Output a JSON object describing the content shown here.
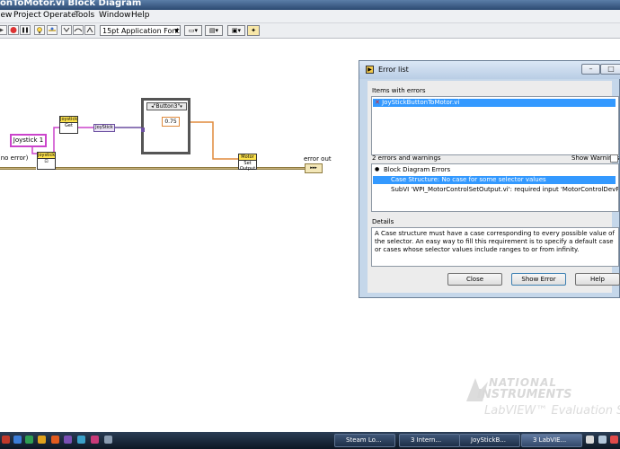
{
  "window": {
    "title": "onToMotor.vi Block Diagram"
  },
  "menu": [
    "iew",
    "Project",
    "Operate",
    "Tools",
    "Window",
    "Help"
  ],
  "toolbar": {
    "font": "15pt Application Font"
  },
  "diagram": {
    "joystick_label": "Joystick 1",
    "no_error_label": "(no error)",
    "joystick_get_title": "Joystick",
    "joystick_get_body": "Get",
    "joystick_open_title": "Joystick",
    "case_selector": "\"Button3\"",
    "constant_value": "0.75",
    "motor_title": "Motor",
    "motor_body": "Set Output",
    "error_out_label": "error out",
    "cluster_label": "JoyStick"
  },
  "error_window": {
    "title": "Error list",
    "items_header": "Items with errors",
    "items": [
      "JoyStickButtonToMotor.vi"
    ],
    "count_label": "2 errors and warnings",
    "show_warnings_label": "Show Warnings",
    "group_label": "Block Diagram Errors",
    "errors": [
      "Case Structure: No case for some selector values",
      "SubVI 'WPI_MotorControlSetOutput.vi': required input 'MotorControlDevRef'"
    ],
    "details_header": "Details",
    "details_text": "A Case structure must have a case corresponding to every possible value of the selector.  An easy way to fill this requirement is to specify a default case or cases whose selector values include ranges to or from infinity.",
    "close_label": "Close",
    "show_error_label": "Show Error",
    "help_label": "Help"
  },
  "watermark": {
    "line1": "NATIONAL",
    "line2": "INSTRUMENTS",
    "line3": "LabVIEW™ Evaluation Soft"
  },
  "taskbar": {
    "tasks": [
      "Steam Lo...",
      "3 Intern...",
      "JoyStickB...",
      "3 LabVIE..."
    ]
  },
  "colors": {
    "error_wire": "#c8b27d",
    "pink_wire": "#cc44cc",
    "orange_wire": "#e08a3c",
    "selection": "#3399ff"
  }
}
